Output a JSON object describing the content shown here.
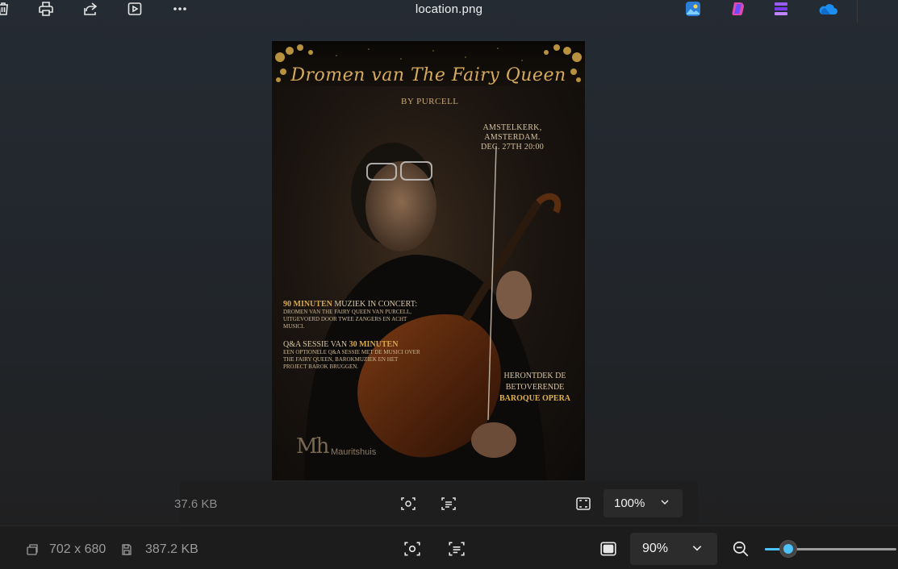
{
  "window": {
    "title": "location.png"
  },
  "toolbar": {
    "delete_icon": "trash-icon",
    "print_icon": "print-icon",
    "share_icon": "share-icon",
    "slideshow_icon": "slideshow-icon",
    "more_icon": "more-icon"
  },
  "apps": [
    "photos-app-icon",
    "copilot-icon",
    "clipchamp-icon",
    "onedrive-icon"
  ],
  "poster": {
    "title": "Dromen van The Fairy Queen",
    "by": "BY PURCELL",
    "venue_line1": "AMSTELKERK, AMSTERDAM.",
    "venue_line2": "DEC. 27TH 20:00",
    "block1_head_bold": "90 MINUTEN",
    "block1_head_rest": " MUZIEK IN CONCERT:",
    "block1_body": "DROMEN VAN THE FAIRY QUEEN VAN PURCELL, UITGEVOERD DOOR TWEE ZANGERS EN ACHT MUSICI.",
    "block2_head_rest": "Q&A SESSIE VAN ",
    "block2_head_bold": "30 MINUTEN",
    "block2_body": "EEN OPTIONELE Q&A SESSIE MET DE MUSICI OVER THE FAIRY QUEEN, BAROKMUZIEK EN HET PROJECT BAROK BRUGGEN.",
    "right_line1": "HERONTDEK DE",
    "right_line2": "BETOVERENDE",
    "right_line3": "BAROQUE OPERA",
    "logo_mark": "Mh",
    "logo_text": "Mauritshuis"
  },
  "ghost_bar": {
    "size_text": "37.6 KB",
    "zoom_value": "100%"
  },
  "statusbar": {
    "dimensions": "702 x 680",
    "file_size": "387.2 KB",
    "zoom_value": "90%",
    "zoom_fraction": 0.18
  },
  "colors": {
    "accent": "#4cc2ff",
    "poster_gold": "#d6aa5c"
  }
}
